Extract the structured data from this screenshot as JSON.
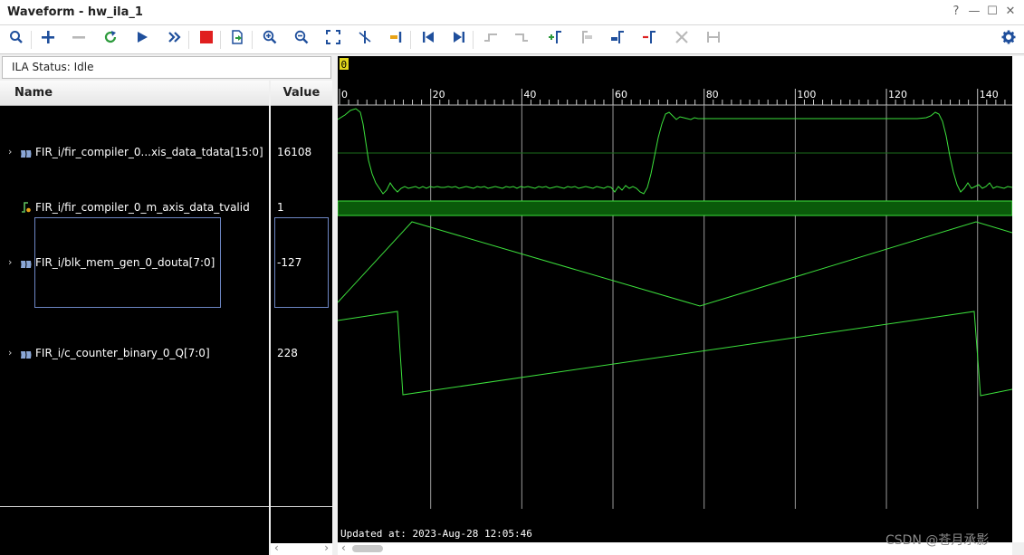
{
  "window": {
    "title": "Waveform - hw_ila_1",
    "help_label": "?",
    "minimize_label": "—",
    "maximize_label": "☐",
    "close_label": "✕"
  },
  "toolbar": {
    "icons": [
      "search-icon",
      "add-icon",
      "remove-icon",
      "refresh-icon",
      "run-trigger-icon",
      "run-immediate-icon",
      "stop-icon",
      "export-icon",
      "zoom-in-icon",
      "zoom-out-icon",
      "zoom-fit-icon",
      "cursor-icon",
      "go-to-time-icon",
      "go-to-start-icon",
      "go-to-end-icon",
      "previous-transition-icon",
      "next-transition-icon",
      "add-marker-icon",
      "previous-marker-icon",
      "next-marker-icon",
      "swap-cursors-icon",
      "delete-icon",
      "snap-icon",
      "settings-icon"
    ]
  },
  "ila_status": "ILA Status: Idle",
  "columns": {
    "name": "Name",
    "value": "Value"
  },
  "signals": [
    {
      "name": "FIR_i/fir_compiler_0...xis_data_tdata[15:0]",
      "value": "16108"
    },
    {
      "name": "FIR_i/fir_compiler_0_m_axis_data_tvalid",
      "value": "1"
    },
    {
      "name": "FIR_i/blk_mem_gen_0_douta[7:0]",
      "value": "-127"
    },
    {
      "name": "FIR_i/c_counter_binary_0_Q[7:0]",
      "value": "228"
    }
  ],
  "cursor_label": "0",
  "timeline": {
    "ticks": [
      "0",
      "20",
      "40",
      "60",
      "80",
      "100",
      "120",
      "140"
    ],
    "range": [
      0,
      148
    ]
  },
  "updated_at": "Updated at: 2023-Aug-28 12:05:46",
  "watermark": "CSDN @苍月承影",
  "colors": {
    "wave": "#3ce03c",
    "background": "#000000",
    "grid": "#9a9a9a",
    "bus_fill": "#0a5a0a"
  }
}
